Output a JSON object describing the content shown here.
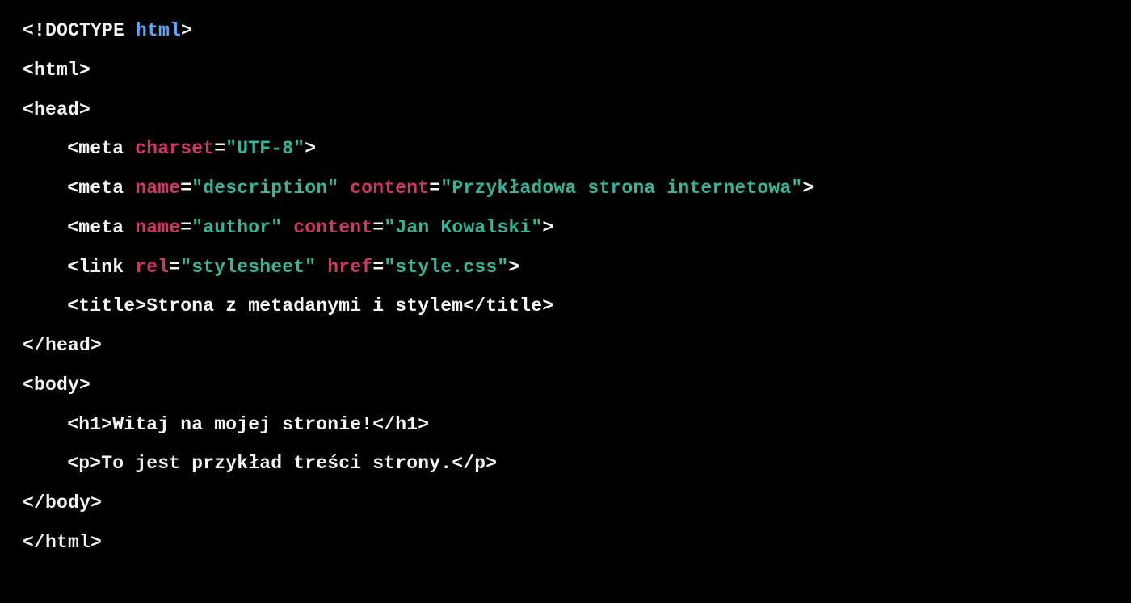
{
  "tokens": {
    "l1": {
      "a": "<!DOCTYPE ",
      "b": "html",
      "c": ">"
    },
    "l2": {
      "a": "<html>"
    },
    "l3": {
      "a": "<head>"
    },
    "l4": {
      "a": "<meta ",
      "b": "charset",
      "c": "=",
      "d": "\"UTF-8\"",
      "e": ">"
    },
    "l5": {
      "a": "<meta ",
      "b": "name",
      "c": "=",
      "d": "\"description\"",
      "e": " ",
      "f": "content",
      "g": "=",
      "h": "\"Przykładowa strona internetowa\"",
      "i": ">"
    },
    "l6": {
      "a": "<meta ",
      "b": "name",
      "c": "=",
      "d": "\"author\"",
      "e": " ",
      "f": "content",
      "g": "=",
      "h": "\"Jan Kowalski\"",
      "i": ">"
    },
    "l7": {
      "a": "<link ",
      "b": "rel",
      "c": "=",
      "d": "\"stylesheet\"",
      "e": " ",
      "f": "href",
      "g": "=",
      "h": "\"style.css\"",
      "i": ">"
    },
    "l8": {
      "a": "<title>Strona z metadanymi i stylem</title>"
    },
    "l9": {
      "a": "</head>"
    },
    "l10": {
      "a": "<body>"
    },
    "l11": {
      "a": "<h1>Witaj na mojej stronie!</h1>"
    },
    "l12": {
      "a": "<p>To jest przykład treści strony.</p>"
    },
    "l13": {
      "a": "</body>"
    },
    "l14": {
      "a": "</html>"
    }
  }
}
